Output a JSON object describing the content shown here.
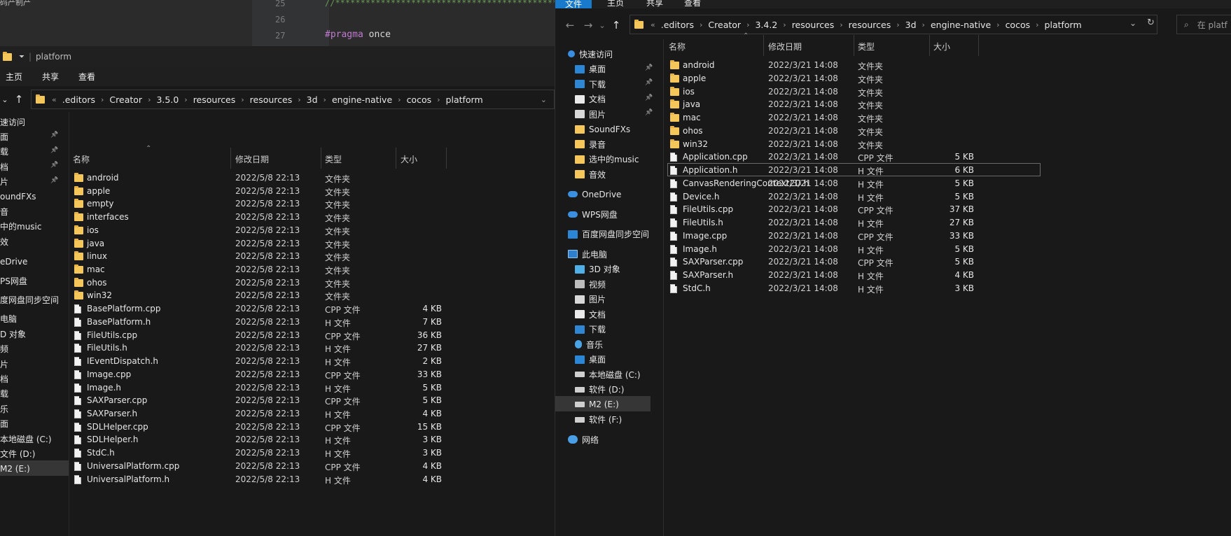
{
  "editor": {
    "line_numbers": [
      "25",
      "26",
      "27"
    ],
    "line25_text": "//*********************************************************************************",
    "pragma_kw": "#pragma",
    "pragma_val": " once",
    "topleft_text": "码产制产"
  },
  "left": {
    "title_path": "platform",
    "tabs": [
      "主页",
      "共享",
      "查看"
    ],
    "crumbs": [
      ".editors",
      "Creator",
      "3.5.0",
      "resources",
      "resources",
      "3d",
      "engine-native",
      "cocos",
      "platform"
    ],
    "columns": {
      "name": "名称",
      "date": "修改日期",
      "type": "类型",
      "size": "大小"
    },
    "sidebar": [
      {
        "label": "速访问",
        "icon": "star",
        "pin": false
      },
      {
        "label": "面",
        "icon": "blue",
        "pin": true
      },
      {
        "label": "载",
        "icon": "dl",
        "pin": true
      },
      {
        "label": "档",
        "icon": "doc",
        "pin": true
      },
      {
        "label": "片",
        "icon": "img",
        "pin": true
      },
      {
        "label": "oundFXs",
        "icon": "folder",
        "pin": false
      },
      {
        "label": "音",
        "icon": "folder",
        "pin": false
      },
      {
        "label": "中的music",
        "icon": "folder",
        "pin": false
      },
      {
        "label": "效",
        "icon": "folder",
        "pin": false
      },
      {
        "label": "eDrive",
        "icon": "cloud",
        "pin": false
      },
      {
        "label": "PS网盘",
        "icon": "cloud",
        "pin": false
      },
      {
        "label": "度网盘同步空间",
        "icon": "blue",
        "pin": false
      },
      {
        "label": "电脑",
        "icon": "pc",
        "pin": false
      },
      {
        "label": "D 对象",
        "icon": "cube",
        "pin": false
      },
      {
        "label": "频",
        "icon": "video",
        "pin": false
      },
      {
        "label": "片",
        "icon": "img",
        "pin": false
      },
      {
        "label": "档",
        "icon": "doc",
        "pin": false
      },
      {
        "label": "载",
        "icon": "dl",
        "pin": false
      },
      {
        "label": "乐",
        "icon": "music",
        "pin": false
      },
      {
        "label": "面",
        "icon": "blue",
        "pin": false
      },
      {
        "label": "本地磁盘 (C:)",
        "icon": "drive",
        "pin": false
      },
      {
        "label": "文件 (D:)",
        "icon": "drive",
        "pin": false
      },
      {
        "label": "M2 (E:)",
        "icon": "drive",
        "pin": false
      }
    ],
    "files": [
      {
        "name": "android",
        "date": "2022/5/8 22:13",
        "type": "文件夹",
        "size": "",
        "kind": "folder"
      },
      {
        "name": "apple",
        "date": "2022/5/8 22:13",
        "type": "文件夹",
        "size": "",
        "kind": "folder"
      },
      {
        "name": "empty",
        "date": "2022/5/8 22:13",
        "type": "文件夹",
        "size": "",
        "kind": "folder"
      },
      {
        "name": "interfaces",
        "date": "2022/5/8 22:13",
        "type": "文件夹",
        "size": "",
        "kind": "folder"
      },
      {
        "name": "ios",
        "date": "2022/5/8 22:13",
        "type": "文件夹",
        "size": "",
        "kind": "folder"
      },
      {
        "name": "java",
        "date": "2022/5/8 22:13",
        "type": "文件夹",
        "size": "",
        "kind": "folder"
      },
      {
        "name": "linux",
        "date": "2022/5/8 22:13",
        "type": "文件夹",
        "size": "",
        "kind": "folder"
      },
      {
        "name": "mac",
        "date": "2022/5/8 22:13",
        "type": "文件夹",
        "size": "",
        "kind": "folder"
      },
      {
        "name": "ohos",
        "date": "2022/5/8 22:13",
        "type": "文件夹",
        "size": "",
        "kind": "folder"
      },
      {
        "name": "win32",
        "date": "2022/5/8 22:13",
        "type": "文件夹",
        "size": "",
        "kind": "folder"
      },
      {
        "name": "BasePlatform.cpp",
        "date": "2022/5/8 22:13",
        "type": "CPP 文件",
        "size": "4 KB",
        "kind": "file"
      },
      {
        "name": "BasePlatform.h",
        "date": "2022/5/8 22:13",
        "type": "H 文件",
        "size": "7 KB",
        "kind": "file"
      },
      {
        "name": "FileUtils.cpp",
        "date": "2022/5/8 22:13",
        "type": "CPP 文件",
        "size": "36 KB",
        "kind": "file"
      },
      {
        "name": "FileUtils.h",
        "date": "2022/5/8 22:13",
        "type": "H 文件",
        "size": "27 KB",
        "kind": "file"
      },
      {
        "name": "IEventDispatch.h",
        "date": "2022/5/8 22:13",
        "type": "H 文件",
        "size": "2 KB",
        "kind": "file"
      },
      {
        "name": "Image.cpp",
        "date": "2022/5/8 22:13",
        "type": "CPP 文件",
        "size": "33 KB",
        "kind": "file"
      },
      {
        "name": "Image.h",
        "date": "2022/5/8 22:13",
        "type": "H 文件",
        "size": "5 KB",
        "kind": "file"
      },
      {
        "name": "SAXParser.cpp",
        "date": "2022/5/8 22:13",
        "type": "CPP 文件",
        "size": "5 KB",
        "kind": "file"
      },
      {
        "name": "SAXParser.h",
        "date": "2022/5/8 22:13",
        "type": "H 文件",
        "size": "4 KB",
        "kind": "file"
      },
      {
        "name": "SDLHelper.cpp",
        "date": "2022/5/8 22:13",
        "type": "CPP 文件",
        "size": "15 KB",
        "kind": "file"
      },
      {
        "name": "SDLHelper.h",
        "date": "2022/5/8 22:13",
        "type": "H 文件",
        "size": "3 KB",
        "kind": "file"
      },
      {
        "name": "StdC.h",
        "date": "2022/5/8 22:13",
        "type": "H 文件",
        "size": "3 KB",
        "kind": "file"
      },
      {
        "name": "UniversalPlatform.cpp",
        "date": "2022/5/8 22:13",
        "type": "CPP 文件",
        "size": "4 KB",
        "kind": "file"
      },
      {
        "name": "UniversalPlatform.h",
        "date": "2022/5/8 22:13",
        "type": "H 文件",
        "size": "4 KB",
        "kind": "file"
      }
    ]
  },
  "right": {
    "tabs": [
      "文件",
      "主页",
      "共享",
      "查看"
    ],
    "crumbs": [
      ".editors",
      "Creator",
      "3.4.2",
      "resources",
      "resources",
      "3d",
      "engine-native",
      "cocos",
      "platform"
    ],
    "search_placeholder": "在 platf",
    "columns": {
      "name": "名称",
      "date": "修改日期",
      "type": "类型",
      "size": "大小"
    },
    "sidebar": [
      {
        "label": "快速访问",
        "icon": "star",
        "pin": false
      },
      {
        "label": "桌面",
        "icon": "blue",
        "pin": true
      },
      {
        "label": "下载",
        "icon": "dl",
        "pin": true
      },
      {
        "label": "文档",
        "icon": "doc",
        "pin": true
      },
      {
        "label": "图片",
        "icon": "img",
        "pin": true
      },
      {
        "label": "SoundFXs",
        "icon": "folder",
        "pin": false
      },
      {
        "label": "录音",
        "icon": "folder",
        "pin": false
      },
      {
        "label": "选中的music",
        "icon": "folder",
        "pin": false
      },
      {
        "label": "音效",
        "icon": "folder",
        "pin": false
      },
      {
        "label": "OneDrive",
        "icon": "cloud",
        "pin": false
      },
      {
        "label": "WPS网盘",
        "icon": "cloud",
        "pin": false
      },
      {
        "label": "百度网盘同步空间",
        "icon": "blue",
        "pin": false
      },
      {
        "label": "此电脑",
        "icon": "pc",
        "pin": false
      },
      {
        "label": "3D 对象",
        "icon": "cube",
        "pin": false
      },
      {
        "label": "视频",
        "icon": "video",
        "pin": false
      },
      {
        "label": "图片",
        "icon": "img",
        "pin": false
      },
      {
        "label": "文档",
        "icon": "doc",
        "pin": false
      },
      {
        "label": "下载",
        "icon": "dl",
        "pin": false
      },
      {
        "label": "音乐",
        "icon": "music",
        "pin": false
      },
      {
        "label": "桌面",
        "icon": "blue",
        "pin": false
      },
      {
        "label": "本地磁盘 (C:)",
        "icon": "drive",
        "pin": false
      },
      {
        "label": "软件 (D:)",
        "icon": "drive",
        "pin": false
      },
      {
        "label": "M2 (E:)",
        "icon": "drive",
        "pin": false
      },
      {
        "label": "软件 (F:)",
        "icon": "drive",
        "pin": false
      },
      {
        "label": "网络",
        "icon": "net",
        "pin": false
      }
    ],
    "files": [
      {
        "name": "android",
        "date": "2022/3/21 14:08",
        "type": "文件夹",
        "size": "",
        "kind": "folder"
      },
      {
        "name": "apple",
        "date": "2022/3/21 14:08",
        "type": "文件夹",
        "size": "",
        "kind": "folder"
      },
      {
        "name": "ios",
        "date": "2022/3/21 14:08",
        "type": "文件夹",
        "size": "",
        "kind": "folder"
      },
      {
        "name": "java",
        "date": "2022/3/21 14:08",
        "type": "文件夹",
        "size": "",
        "kind": "folder"
      },
      {
        "name": "mac",
        "date": "2022/3/21 14:08",
        "type": "文件夹",
        "size": "",
        "kind": "folder"
      },
      {
        "name": "ohos",
        "date": "2022/3/21 14:08",
        "type": "文件夹",
        "size": "",
        "kind": "folder"
      },
      {
        "name": "win32",
        "date": "2022/3/21 14:08",
        "type": "文件夹",
        "size": "",
        "kind": "folder"
      },
      {
        "name": "Application.cpp",
        "date": "2022/3/21 14:08",
        "type": "CPP 文件",
        "size": "5 KB",
        "kind": "file"
      },
      {
        "name": "Application.h",
        "date": "2022/3/21 14:08",
        "type": "H 文件",
        "size": "6 KB",
        "kind": "file"
      },
      {
        "name": "CanvasRenderingContext2D.h",
        "date": "2022/3/21 14:08",
        "type": "H 文件",
        "size": "5 KB",
        "kind": "file"
      },
      {
        "name": "Device.h",
        "date": "2022/3/21 14:08",
        "type": "H 文件",
        "size": "5 KB",
        "kind": "file"
      },
      {
        "name": "FileUtils.cpp",
        "date": "2022/3/21 14:08",
        "type": "CPP 文件",
        "size": "37 KB",
        "kind": "file"
      },
      {
        "name": "FileUtils.h",
        "date": "2022/3/21 14:08",
        "type": "H 文件",
        "size": "27 KB",
        "kind": "file"
      },
      {
        "name": "Image.cpp",
        "date": "2022/3/21 14:08",
        "type": "CPP 文件",
        "size": "33 KB",
        "kind": "file"
      },
      {
        "name": "Image.h",
        "date": "2022/3/21 14:08",
        "type": "H 文件",
        "size": "5 KB",
        "kind": "file"
      },
      {
        "name": "SAXParser.cpp",
        "date": "2022/3/21 14:08",
        "type": "CPP 文件",
        "size": "5 KB",
        "kind": "file"
      },
      {
        "name": "SAXParser.h",
        "date": "2022/3/21 14:08",
        "type": "H 文件",
        "size": "4 KB",
        "kind": "file"
      },
      {
        "name": "StdC.h",
        "date": "2022/3/21 14:08",
        "type": "H 文件",
        "size": "3 KB",
        "kind": "file"
      }
    ]
  },
  "colors": {
    "file_tab": "#1979ca",
    "folder": "#f5c75a",
    "pragma": "#c07ad0",
    "comment": "#6a9955"
  }
}
